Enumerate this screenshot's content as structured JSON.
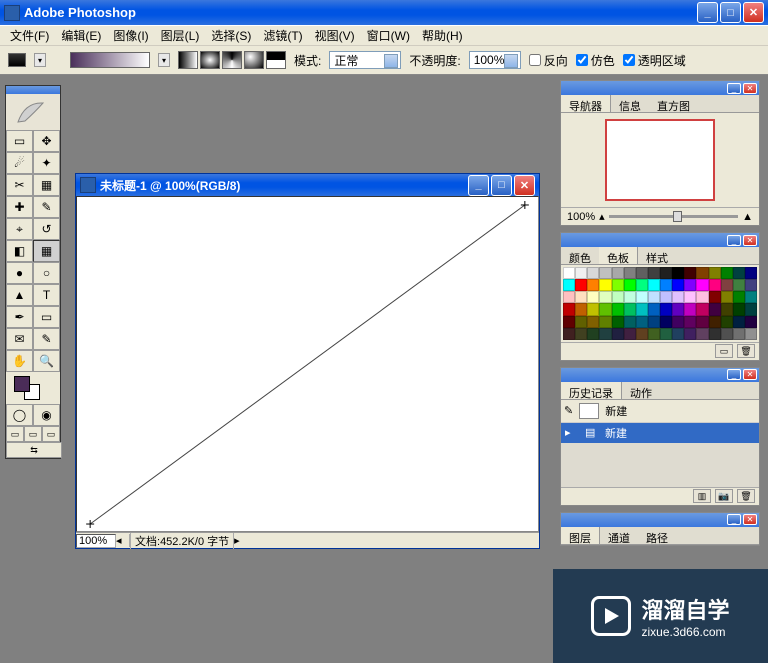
{
  "app": {
    "title": "Adobe Photoshop"
  },
  "menu": [
    "文件(F)",
    "编辑(E)",
    "图像(I)",
    "图层(L)",
    "选择(S)",
    "滤镜(T)",
    "视图(V)",
    "窗口(W)",
    "帮助(H)"
  ],
  "options": {
    "mode_label": "模式:",
    "mode_value": "正常",
    "opacity_label": "不透明度:",
    "opacity_value": "100%",
    "reverse": "反向",
    "dither": "仿色",
    "transparency": "透明区域"
  },
  "document": {
    "title": "未标题-1 @ 100%(RGB/8)",
    "zoom": "100%",
    "info_label": "文档:",
    "info_value": "452.2K/0 字节"
  },
  "panels": {
    "navigator": {
      "tabs": [
        "导航器",
        "信息",
        "直方图"
      ],
      "zoom": "100%"
    },
    "swatches": {
      "tabs": [
        "颜色",
        "色板",
        "样式"
      ]
    },
    "history": {
      "tabs": [
        "历史记录",
        "动作"
      ],
      "snapshot": "新建",
      "item": "新建"
    },
    "layers": {
      "tabs": [
        "图层",
        "通道",
        "路径"
      ]
    }
  },
  "swatch_colors": [
    "#ffffff",
    "#f0f0f0",
    "#d8d8d8",
    "#c0c0c0",
    "#a8a8a8",
    "#808080",
    "#606060",
    "#404040",
    "#202020",
    "#000000",
    "#400000",
    "#804000",
    "#808000",
    "#008000",
    "#004040",
    "#000080",
    "#00ffff",
    "#ff0000",
    "#ff8000",
    "#ffff00",
    "#80ff00",
    "#00ff00",
    "#00ff80",
    "#00ffff",
    "#0080ff",
    "#0000ff",
    "#8000ff",
    "#ff00ff",
    "#ff0080",
    "#804040",
    "#408040",
    "#404080",
    "#ffc0c0",
    "#ffe0c0",
    "#ffffc0",
    "#e0ffc0",
    "#c0ffc0",
    "#c0ffe0",
    "#c0ffff",
    "#c0e0ff",
    "#c0c0ff",
    "#e0c0ff",
    "#ffc0ff",
    "#ffc0e0",
    "#800000",
    "#808000",
    "#008000",
    "#008080",
    "#c00000",
    "#c06000",
    "#c0c000",
    "#60c000",
    "#00c000",
    "#00c060",
    "#00c0c0",
    "#0060c0",
    "#0000c0",
    "#6000c0",
    "#c000c0",
    "#c00060",
    "#400040",
    "#404000",
    "#004000",
    "#004040",
    "#600000",
    "#606000",
    "#806000",
    "#608000",
    "#006000",
    "#006060",
    "#006080",
    "#004080",
    "#000060",
    "#400060",
    "#600060",
    "#600040",
    "#402000",
    "#204000",
    "#002040",
    "#200040",
    "#402020",
    "#404020",
    "#204020",
    "#204040",
    "#202040",
    "#402040",
    "#604020",
    "#406020",
    "#206040",
    "#204060",
    "#402060",
    "#604060",
    "#303030",
    "#505050",
    "#707070",
    "#909090"
  ],
  "watermark": {
    "title": "溜溜自学",
    "sub": "zixue.3d66.com"
  }
}
